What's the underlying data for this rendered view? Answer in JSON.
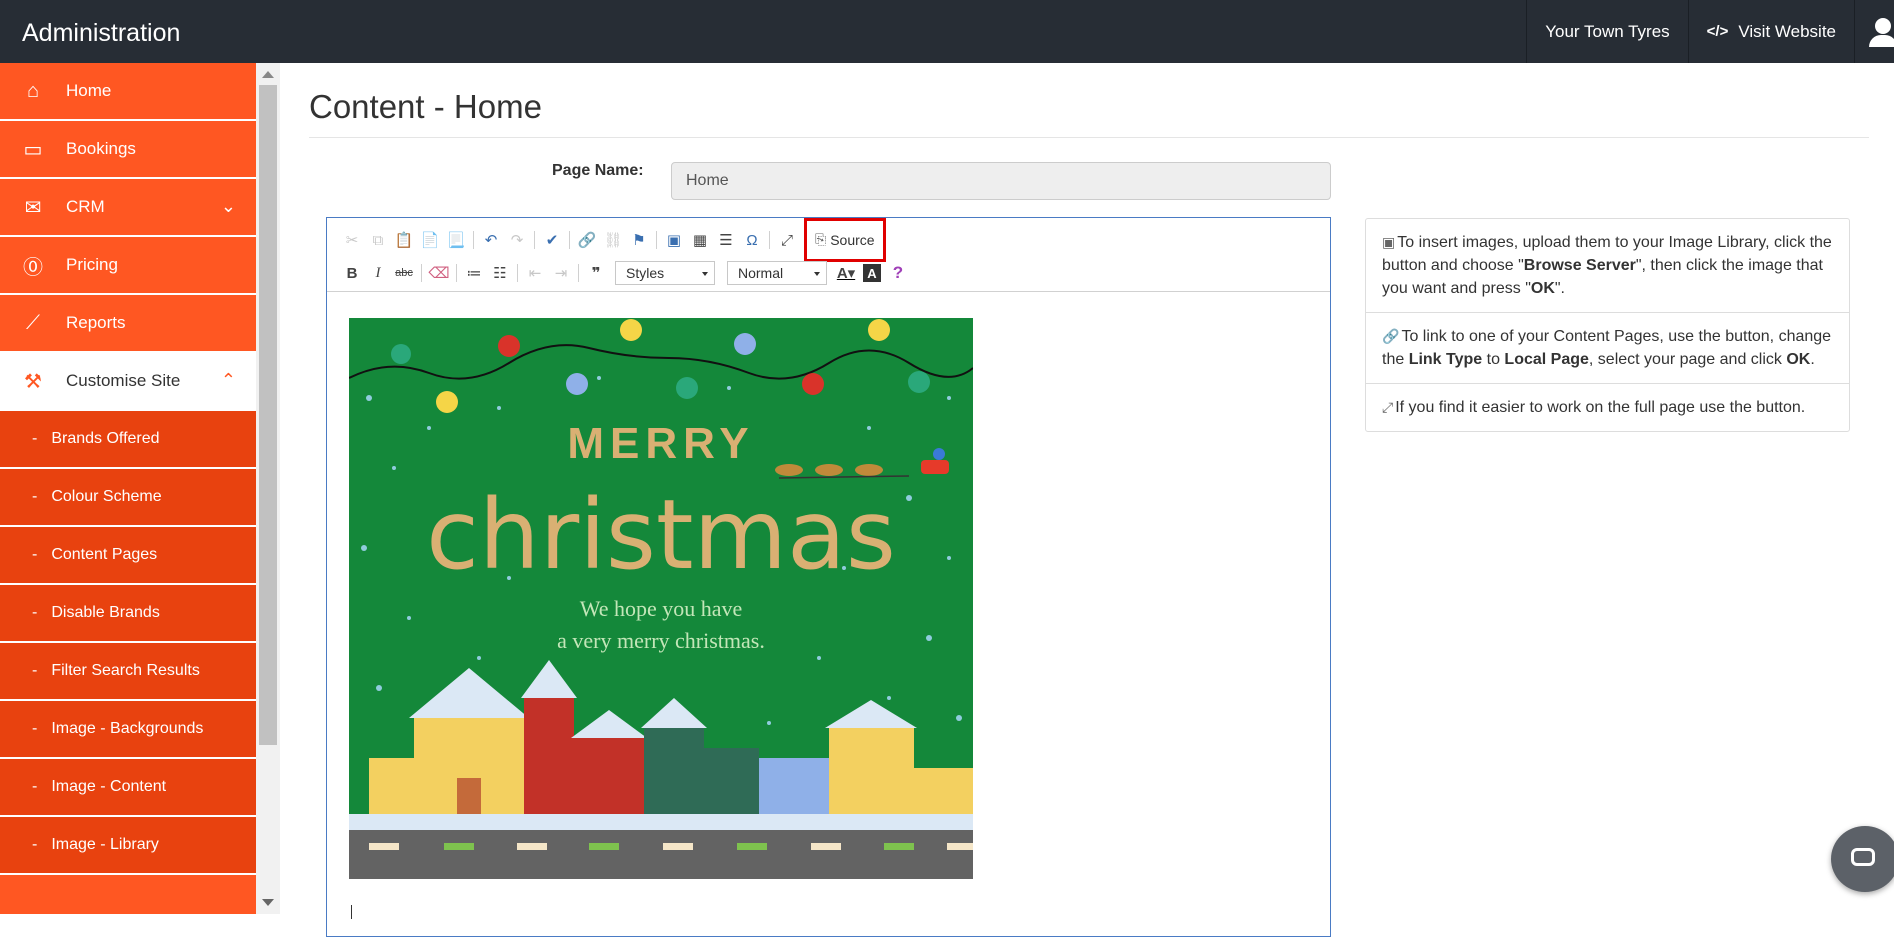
{
  "header": {
    "title": "Administration",
    "site_name": "Your Town Tyres",
    "visit_label": "Visit Website"
  },
  "sidebar": {
    "items": [
      {
        "label": "Home",
        "icon": "home-icon"
      },
      {
        "label": "Bookings",
        "icon": "card-icon"
      },
      {
        "label": "CRM",
        "icon": "envelope-icon"
      },
      {
        "label": "Pricing",
        "icon": "currency-icon"
      },
      {
        "label": "Reports",
        "icon": "chart-icon"
      },
      {
        "label": "Customise Site",
        "icon": "paint-roller-icon"
      }
    ],
    "subitems": [
      "Brands Offered",
      "Colour Scheme",
      "Content Pages",
      "Disable Brands",
      "Filter Search Results",
      "Image - Backgrounds",
      "Image - Content",
      "Image - Library"
    ]
  },
  "page": {
    "title": "Content - Home",
    "page_name_label": "Page Name:",
    "page_name_value": "Home"
  },
  "editor": {
    "source_label": "Source",
    "styles_label": "Styles",
    "format_label": "Normal",
    "card": {
      "merry": "MERRY",
      "christmas": "christmas",
      "line1": "We hope you have",
      "line2": "a very merry christmas."
    }
  },
  "tips": {
    "t1_a": "To insert images, upload them to your Image Library, click the button and choose \"",
    "t1_b": "Browse Server",
    "t1_c": "\", then click the image that you want and press \"",
    "t1_d": "OK",
    "t1_e": "\".",
    "t2_a": "To link to one of your Content Pages, use the button, change the ",
    "t2_b": "Link Type",
    "t2_c": " to ",
    "t2_d": "Local Page",
    "t2_e": ", select your page and click ",
    "t2_f": "OK",
    "t2_g": ".",
    "t3": "If you find it easier to work on the full page use the button."
  },
  "colors": {
    "topbar": "#272d35",
    "sidebar": "#ff5722",
    "sidebar_sub": "#e8420f",
    "card_green": "#14883a",
    "highlight": "#e00000"
  }
}
